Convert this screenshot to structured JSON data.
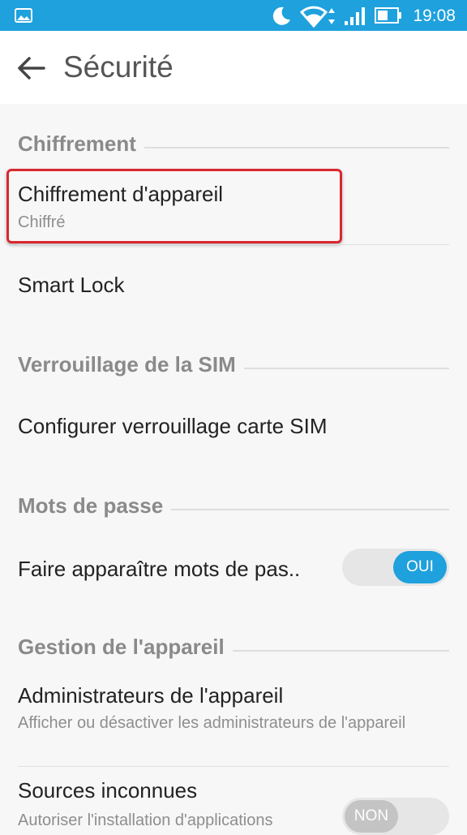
{
  "status_bar": {
    "time": "19:08",
    "icons": [
      "image-notification-icon",
      "moon-icon",
      "wifi-icon",
      "signal-icon",
      "battery-icon"
    ]
  },
  "toolbar": {
    "title": "Sécurité"
  },
  "sections": {
    "encryption": "Chiffrement",
    "sim_lock": "Verrouillage de la SIM",
    "passwords": "Mots de passe",
    "device_admin": "Gestion de l'appareil"
  },
  "items": {
    "device_encryption": {
      "title": "Chiffrement d'appareil",
      "summary": "Chiffré"
    },
    "smart_lock": {
      "title": "Smart Lock"
    },
    "sim_lock_config": {
      "title": "Configurer verrouillage carte SIM"
    },
    "show_passwords": {
      "title": "Faire apparaître mots de pas..",
      "toggle": "OUI",
      "enabled": true
    },
    "device_admins": {
      "title": "Administrateurs de l'appareil",
      "summary": "Afficher ou désactiver les administrateurs de l'appareil"
    },
    "unknown_sources": {
      "title": "Sources inconnues",
      "summary": "Autoriser l'installation d'applications",
      "toggle": "NON",
      "enabled": false
    }
  },
  "colors": {
    "accent": "#1ea1dd",
    "highlight": "#d9282e"
  }
}
